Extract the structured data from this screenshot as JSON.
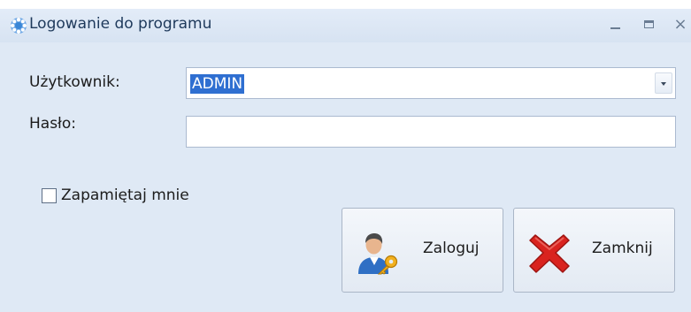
{
  "window": {
    "title": "Logowanie do programu",
    "icon": "gear-globe-icon",
    "controls": {
      "minimize": "minimize-icon",
      "maximize": "maximize-icon",
      "close": "×"
    }
  },
  "form": {
    "user_label": "Użytkownik:",
    "user_value": "ADMIN",
    "password_label": "Hasło:",
    "password_value": "",
    "remember_label": "Zapamiętaj mnie",
    "remember_checked": false
  },
  "buttons": {
    "login_label": "Zaloguj",
    "login_icon": "user-key-icon",
    "close_label": "Zamknij",
    "close_icon": "red-x-icon"
  },
  "colors": {
    "window_bg": "#dfe9f5",
    "title_text": "#1e395b",
    "selection": "#2f6fd1",
    "close_x": "#d9231f"
  }
}
